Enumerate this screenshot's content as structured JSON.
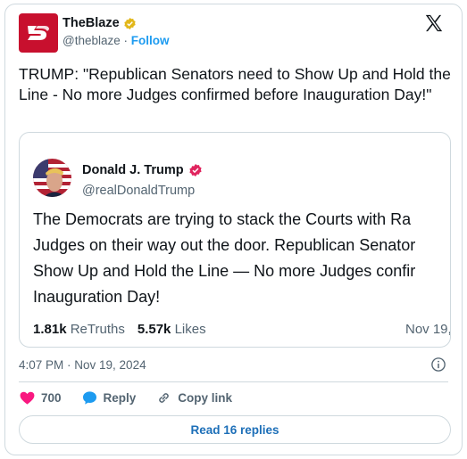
{
  "author": {
    "name": "TheBlaze",
    "handle": "@theblaze",
    "separator": "·",
    "follow_label": "Follow",
    "avatar_color": "#c8102e",
    "verified_color": "#e2b719"
  },
  "tweet": {
    "text": "TRUMP: \"Republican Senators need to Show Up and Hold the Line - No more Judges confirmed before Inauguration Day!\"",
    "timestamp": "4:07 PM · Nov 19, 2024"
  },
  "quote": {
    "author_name": "Donald J. Trump",
    "author_handle": "@realDonaldTrump",
    "verified_color": "#e0245e",
    "lines": [
      "The Democrats are trying to stack the Courts with Ra",
      "Judges on their way out the door. Republican Senator",
      "Show Up and Hold the Line — No more Judges confir",
      "Inauguration Day!"
    ],
    "retruths_count": "1.81k",
    "retruths_label": "ReTruths",
    "likes_count": "5.57k",
    "likes_label": "Likes",
    "date": "Nov 19,"
  },
  "actions": {
    "like_count": "700",
    "reply_label": "Reply",
    "copy_link_label": "Copy link",
    "like_color": "#f91880",
    "reply_color": "#1d9bf0"
  },
  "read_replies_label": "Read 16 replies",
  "icons": [
    "blaze-logo",
    "verified-badge-icon",
    "x-logo-icon",
    "info-icon",
    "heart-icon",
    "reply-bubble-icon",
    "link-icon"
  ]
}
